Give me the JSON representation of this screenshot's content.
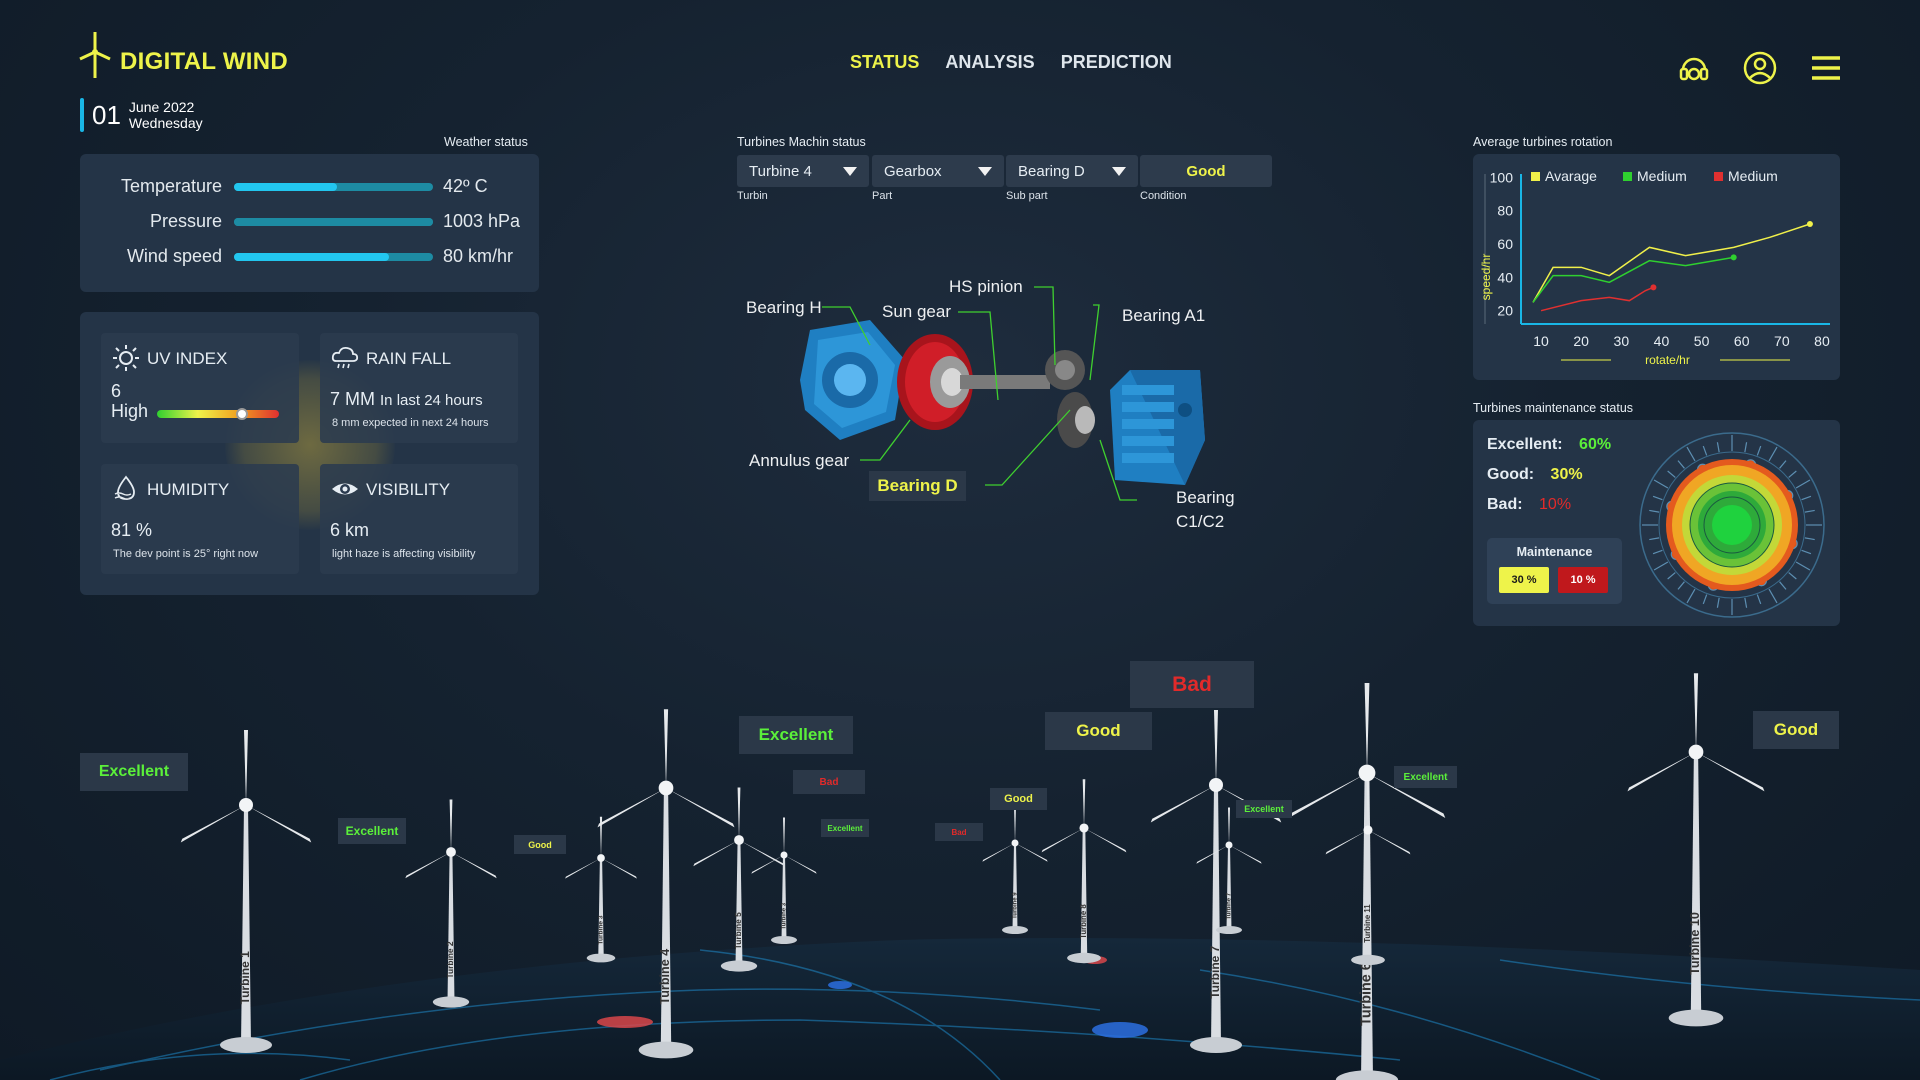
{
  "brand": {
    "name": "DIGITAL WIND"
  },
  "date": {
    "day": "01",
    "month_year": "June 2022",
    "weekday": "Wednesday"
  },
  "nav": {
    "items": [
      "STATUS",
      "ANALYSIS",
      "PREDICTION"
    ],
    "active": "STATUS"
  },
  "weather": {
    "title": "Weather status",
    "rows": [
      {
        "label": "Temperature",
        "value": "42º C",
        "level": 0.52
      },
      {
        "label": "Pressure",
        "value": "1003 hPa",
        "level": 1.0
      },
      {
        "label": "Wind speed",
        "value": "80 km/hr",
        "level": 0.78
      }
    ]
  },
  "cards": {
    "uv": {
      "title": "UV  INDEX",
      "value": "6",
      "level_text": "High",
      "level": 0.7
    },
    "rain": {
      "title": "RAIN FALL",
      "value": "7 MM",
      "value_suffix": "In last 24 hours",
      "note": "8 mm expected in next 24 hours"
    },
    "humidity": {
      "title": "HUMIDITY",
      "value": "81 %",
      "note": "The dev point is 25° right now"
    },
    "visibility": {
      "title": "VISIBILITY",
      "value": "6 km",
      "note": "light haze is affecting visibility"
    }
  },
  "machine": {
    "title": "Turbines Machin status",
    "turbine": {
      "value": "Turbine 4",
      "label": "Turbin"
    },
    "part": {
      "value": "Gearbox",
      "label": "Part"
    },
    "subpart": {
      "value": "Bearing D",
      "label": "Sub part"
    },
    "condition": {
      "value": "Good",
      "label": "Condition"
    },
    "parts": {
      "bearing_h": "Bearing H",
      "sun_gear": "Sun gear",
      "hs_pinion": "HS pinion",
      "bearing_a1": "Bearing A1",
      "annulus_gear": "Annulus gear",
      "bearing_d": "Bearing D",
      "bearing_c1": "Bearing",
      "bearing_c2": "C1/C2"
    }
  },
  "rotation": {
    "title": "Average turbines rotation",
    "legend": [
      {
        "name": "Avarage",
        "color": "#f0f04a"
      },
      {
        "name": "Medium",
        "color": "#2fd02f"
      },
      {
        "name": "Medium",
        "color": "#e03030"
      }
    ]
  },
  "chart_data": {
    "type": "line",
    "xlabel": "rotate/hr",
    "ylabel": "speed/hr",
    "xlim": [
      5,
      82
    ],
    "ylim": [
      12,
      102
    ],
    "xticks": [
      10,
      20,
      30,
      40,
      50,
      60,
      70,
      80
    ],
    "yticks": [
      20,
      40,
      60,
      80,
      100
    ],
    "series": [
      {
        "name": "Avarage",
        "color": "#f0f04a",
        "x": [
          8,
          13,
          20,
          27,
          37,
          46,
          58,
          67,
          77
        ],
        "y": [
          25,
          46,
          46,
          41,
          58,
          53,
          58,
          64,
          72
        ]
      },
      {
        "name": "Medium",
        "color": "#2fd02f",
        "x": [
          8,
          13,
          20,
          27,
          37,
          46,
          58
        ],
        "y": [
          25,
          41,
          41,
          37,
          50,
          47,
          52
        ]
      },
      {
        "name": "Medium",
        "color": "#e03030",
        "x": [
          10,
          20,
          27,
          32,
          36,
          38
        ],
        "y": [
          20,
          26,
          28,
          26,
          32,
          34
        ]
      }
    ]
  },
  "maintenance": {
    "title": "Turbines maintenance status",
    "rows": [
      {
        "label": "Excellent:",
        "value": "60%",
        "color": "#5bf03a"
      },
      {
        "label": "Good:",
        "value": "30%",
        "color": "#eef34a"
      },
      {
        "label": "Bad:",
        "value": "10%",
        "color": "#e22a2a"
      }
    ],
    "box_title": "Maintenance",
    "good_pct": "30 %",
    "bad_pct": "10 %"
  },
  "turbines": {
    "labels": [
      "Turbine 1",
      "Turbine 2",
      "Turbine 3",
      "Turbine 4",
      "Turbine 5",
      "Turbine 6",
      "Turbine 7",
      "Turbine 8",
      "Turbine 9",
      "Turbine 10",
      "Turbine 11",
      "Turbine 3"
    ],
    "tags": [
      "Excellent",
      "Excellent",
      "Good",
      "Excellent",
      "Bad",
      "Excellent",
      "Bad",
      "Good",
      "Good",
      "Bad",
      "Excellent",
      "Excellent",
      "Good"
    ]
  }
}
